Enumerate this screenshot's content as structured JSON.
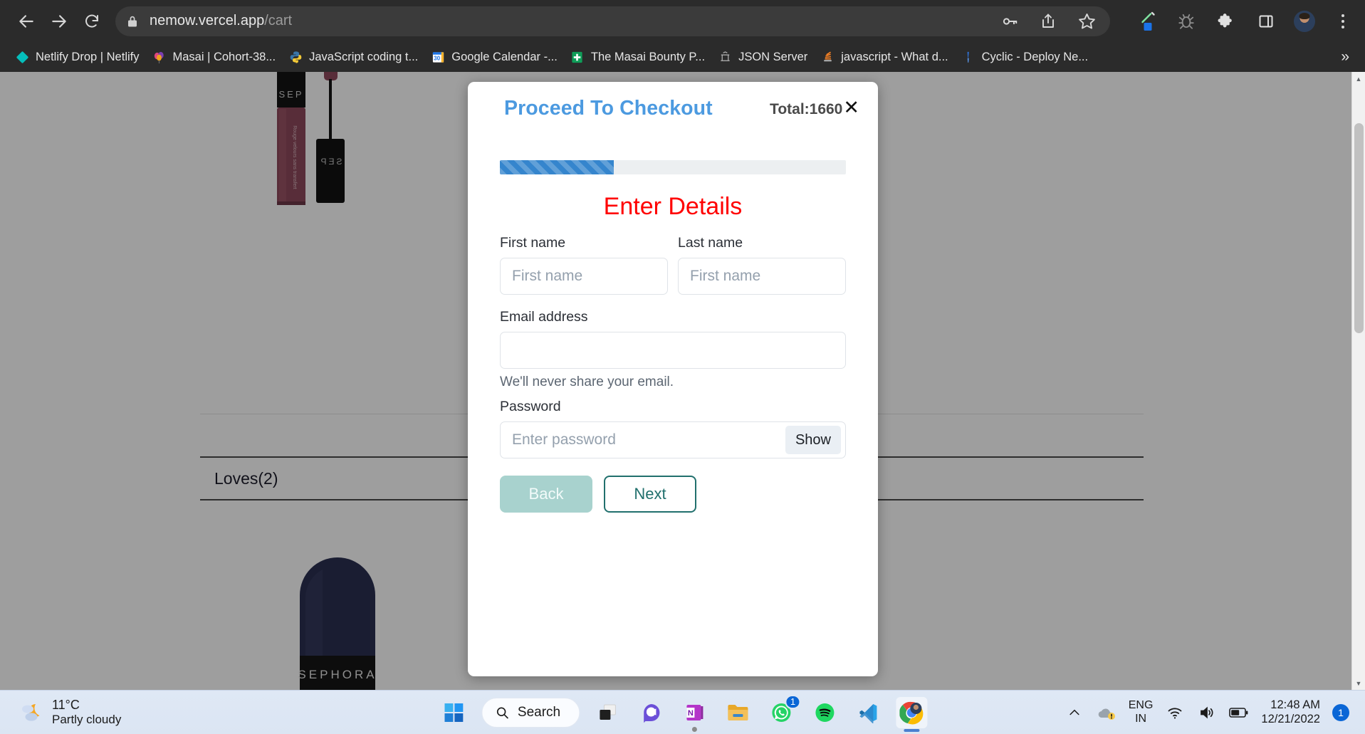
{
  "browser": {
    "url_host": "nemow.vercel.app",
    "url_path": "/cart",
    "nav": {
      "back": "back-arrow",
      "forward": "forward-arrow",
      "reload": "reload"
    },
    "omnibox_actions": [
      "password-key-icon",
      "share-icon",
      "bookmark-star-icon"
    ],
    "extension_icons": [
      "eyedropper-icon",
      "bug-icon",
      "puzzle-extensions-icon",
      "side-panel-icon"
    ],
    "profile": "user-avatar",
    "menu": "three-dot-menu",
    "bookmarks": [
      {
        "label": "Netlify Drop | Netlify",
        "icon": "netlify-diamond-icon"
      },
      {
        "label": "Masai | Cohort-38...",
        "icon": "balloon-icon"
      },
      {
        "label": "JavaScript coding t...",
        "icon": "python-icon"
      },
      {
        "label": "Google Calendar -...",
        "icon": "calendar-30-icon"
      },
      {
        "label": "The Masai Bounty P...",
        "icon": "sheets-icon"
      },
      {
        "label": "JSON Server",
        "icon": "json-server-icon"
      },
      {
        "label": "javascript - What d...",
        "icon": "stackoverflow-icon"
      },
      {
        "label": "Cyclic - Deploy Ne...",
        "icon": "cyclic-icon"
      }
    ],
    "bookmarks_overflow": "»"
  },
  "page": {
    "loves_heading": "Loves(2)",
    "product_1_alt": "sephora-cream-lip-stain",
    "product_2_alt": "sephora-navy-product"
  },
  "modal": {
    "title": "Proceed To Checkout",
    "total_label": "Total:1660",
    "close_label": "✕",
    "progress_percent": 33,
    "step_title": "Enter Details",
    "fields": {
      "first_name": {
        "label": "First name",
        "placeholder": "First name",
        "value": ""
      },
      "last_name": {
        "label": "Last name",
        "placeholder": "First name",
        "value": ""
      },
      "email": {
        "label": "Email address",
        "placeholder": "",
        "value": "",
        "help": "We'll never share your email."
      },
      "password": {
        "label": "Password",
        "placeholder": "Enter password",
        "value": "",
        "show_label": "Show"
      }
    },
    "buttons": {
      "back": "Back",
      "next": "Next"
    },
    "colors": {
      "title": "#4c9ae0",
      "step_title": "#ff0000",
      "progress": "#3585cd",
      "back": "#a8d2ce",
      "next": "#21706d"
    }
  },
  "taskbar": {
    "weather": {
      "temp": "11°C",
      "desc": "Partly cloudy",
      "icon": "partly-cloudy-night-icon"
    },
    "search_placeholder": "Search",
    "apps": [
      {
        "name": "start-button",
        "icon": "windows-logo-icon"
      },
      {
        "name": "task-view",
        "icon": "task-view-icon"
      },
      {
        "name": "teams",
        "icon": "teams-chat-icon"
      },
      {
        "name": "onenote",
        "icon": "onenote-icon"
      },
      {
        "name": "file-explorer",
        "icon": "folder-icon"
      },
      {
        "name": "whatsapp",
        "icon": "whatsapp-icon",
        "badge": "1"
      },
      {
        "name": "spotify",
        "icon": "spotify-icon"
      },
      {
        "name": "vscode",
        "icon": "vscode-icon"
      },
      {
        "name": "chrome",
        "icon": "chrome-icon",
        "active": true
      }
    ],
    "tray": {
      "overflow": "show-hidden-icons-chevron",
      "onedrive": "onedrive-warning-icon",
      "lang_top": "ENG",
      "lang_bottom": "IN",
      "wifi": "wifi-icon",
      "volume": "volume-icon",
      "battery": "battery-icon",
      "time": "12:48 AM",
      "date": "12/21/2022",
      "notification_count": "1"
    }
  }
}
